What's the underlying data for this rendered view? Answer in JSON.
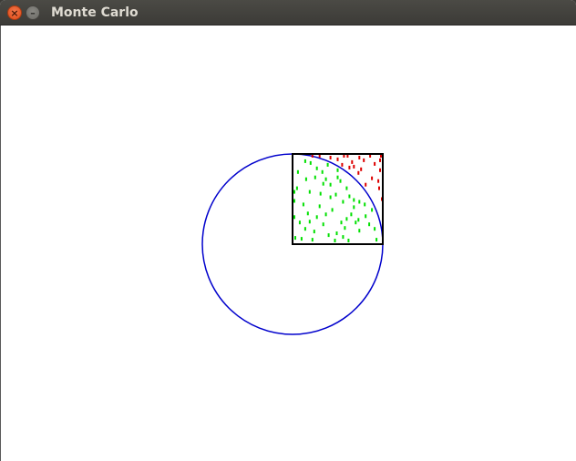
{
  "window": {
    "title": "Monte Carlo",
    "close_glyph": "×",
    "minimize_glyph": "–"
  },
  "colors": {
    "circle": "#0000cc",
    "square": "#000000",
    "inside_point": "#00e000",
    "outside_point": "#dd0000"
  },
  "simulation": {
    "radius": 1,
    "points_outside": [
      [
        0.22,
        0.98
      ],
      [
        0.3,
        0.98
      ],
      [
        0.57,
        0.98
      ],
      [
        0.61,
        0.98
      ],
      [
        0.86,
        0.98
      ],
      [
        0.98,
        0.98
      ],
      [
        0.42,
        0.96
      ],
      [
        0.74,
        0.96
      ],
      [
        0.5,
        0.94
      ],
      [
        0.79,
        0.93
      ],
      [
        0.97,
        0.93
      ],
      [
        0.66,
        0.91
      ],
      [
        0.55,
        0.88
      ],
      [
        0.76,
        0.83
      ],
      [
        0.91,
        0.89
      ],
      [
        0.73,
        0.79
      ],
      [
        0.97,
        0.82
      ],
      [
        0.81,
        0.66
      ],
      [
        0.95,
        0.7
      ],
      [
        0.96,
        0.62
      ],
      [
        0.88,
        0.73
      ],
      [
        0.63,
        0.85
      ],
      [
        0.68,
        0.86
      ],
      [
        0.99,
        0.5
      ]
    ],
    "points_inside": [
      [
        0.2,
        0.9
      ],
      [
        0.27,
        0.84
      ],
      [
        0.14,
        0.92
      ],
      [
        0.39,
        0.88
      ],
      [
        0.33,
        0.8
      ],
      [
        0.5,
        0.82
      ],
      [
        0.06,
        0.8
      ],
      [
        0.15,
        0.72
      ],
      [
        0.25,
        0.74
      ],
      [
        0.37,
        0.72
      ],
      [
        0.42,
        0.66
      ],
      [
        0.53,
        0.7
      ],
      [
        0.6,
        0.62
      ],
      [
        0.05,
        0.62
      ],
      [
        0.19,
        0.58
      ],
      [
        0.31,
        0.56
      ],
      [
        0.48,
        0.55
      ],
      [
        0.56,
        0.47
      ],
      [
        0.63,
        0.53
      ],
      [
        0.68,
        0.49
      ],
      [
        0.74,
        0.47
      ],
      [
        0.02,
        0.48
      ],
      [
        0.12,
        0.44
      ],
      [
        0.17,
        0.34
      ],
      [
        0.3,
        0.42
      ],
      [
        0.37,
        0.33
      ],
      [
        0.44,
        0.38
      ],
      [
        0.54,
        0.24
      ],
      [
        0.6,
        0.28
      ],
      [
        0.65,
        0.33
      ],
      [
        0.7,
        0.24
      ],
      [
        0.74,
        0.15
      ],
      [
        0.02,
        0.3
      ],
      [
        0.08,
        0.24
      ],
      [
        0.14,
        0.17
      ],
      [
        0.24,
        0.14
      ],
      [
        0.34,
        0.22
      ],
      [
        0.4,
        0.1
      ],
      [
        0.49,
        0.12
      ],
      [
        0.56,
        0.08
      ],
      [
        0.03,
        0.07
      ],
      [
        0.1,
        0.06
      ],
      [
        0.22,
        0.05
      ],
      [
        0.47,
        0.04
      ],
      [
        0.85,
        0.22
      ],
      [
        0.91,
        0.17
      ],
      [
        0.88,
        0.38
      ],
      [
        0.8,
        0.44
      ],
      [
        0.34,
        0.67
      ],
      [
        0.42,
        0.52
      ],
      [
        0.68,
        0.41
      ],
      [
        0.58,
        0.18
      ],
      [
        0.93,
        0.05
      ],
      [
        0.02,
        0.58
      ],
      [
        0.5,
        0.74
      ],
      [
        0.73,
        0.27
      ],
      [
        0.81,
        0.31
      ],
      [
        0.27,
        0.3
      ],
      [
        0.19,
        0.25
      ],
      [
        0.62,
        0.04
      ]
    ]
  }
}
